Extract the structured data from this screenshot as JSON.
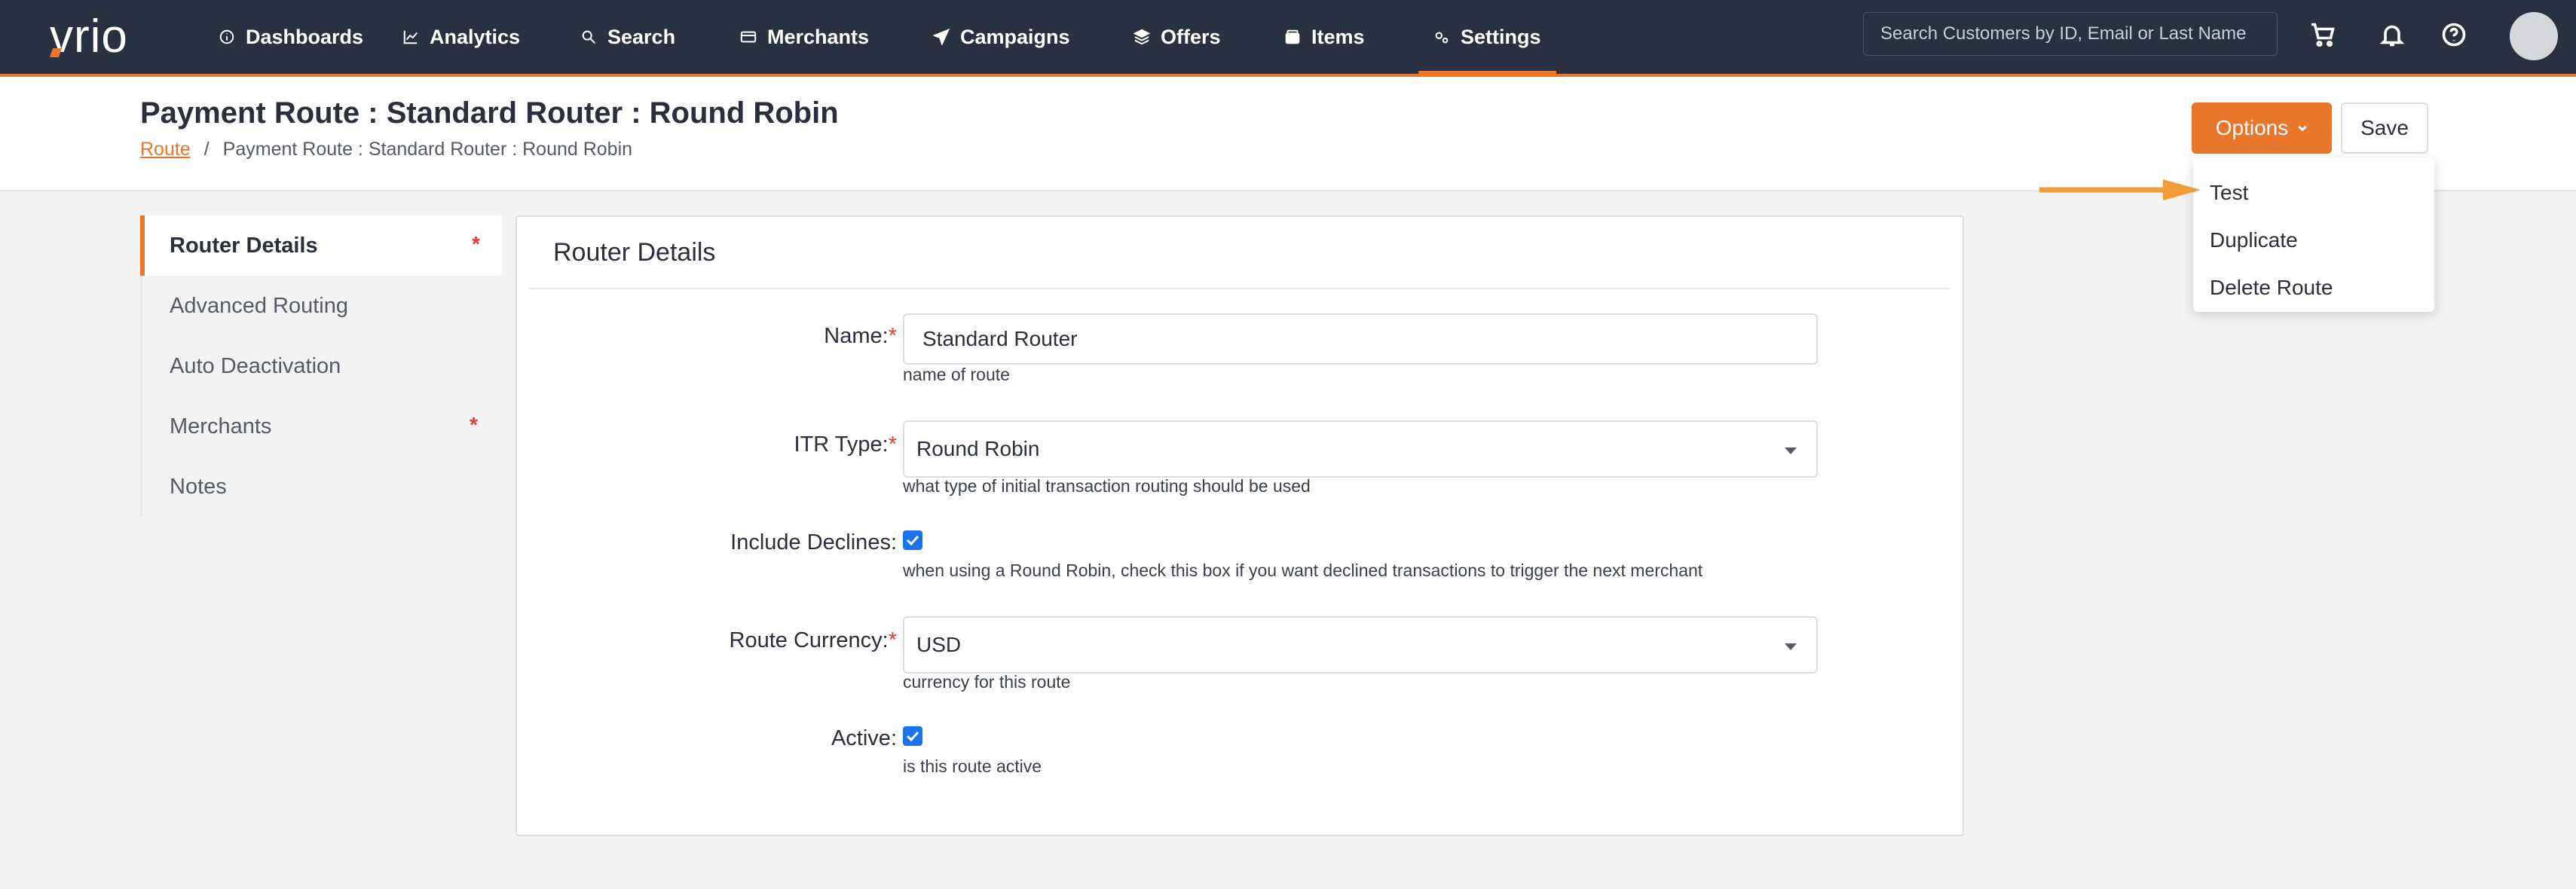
{
  "app": {
    "logo_text": "vrio"
  },
  "nav": {
    "items": [
      {
        "label": "Dashboards",
        "icon": "info-circle-icon"
      },
      {
        "label": "Analytics",
        "icon": "line-chart-icon"
      },
      {
        "label": "Search",
        "icon": "search-icon"
      },
      {
        "label": "Merchants",
        "icon": "credit-card-icon"
      },
      {
        "label": "Campaigns",
        "icon": "paper-plane-icon"
      },
      {
        "label": "Offers",
        "icon": "layers-icon"
      },
      {
        "label": "Items",
        "icon": "box-icon"
      },
      {
        "label": "Settings",
        "icon": "cogs-icon",
        "active": true
      }
    ],
    "search_placeholder": "Search Customers by ID, Email or Last Name",
    "accent_color": "#e8772c",
    "background_color": "#293042"
  },
  "header": {
    "title": "Payment Route : Standard Router : Round Robin",
    "breadcrumb": {
      "link": "Route",
      "separator": "/",
      "current": "Payment Route : Standard Router : Round Robin"
    },
    "options_label": "Options",
    "save_label": "Save"
  },
  "options_menu": {
    "items": [
      "Test",
      "Duplicate",
      "Delete Route"
    ]
  },
  "side_menu": {
    "items": [
      {
        "label": "Router Details",
        "active": true,
        "required": "*"
      },
      {
        "label": "Advanced Routing"
      },
      {
        "label": "Auto Deactivation"
      },
      {
        "label": "Merchants",
        "required": "*"
      },
      {
        "label": "Notes"
      }
    ]
  },
  "form": {
    "title": "Router Details",
    "name": {
      "label": "Name:",
      "required": "*",
      "value": "Standard Router",
      "help": "name of route"
    },
    "itr_type": {
      "label": "ITR Type:",
      "required": "*",
      "value": "Round Robin",
      "help": "what type of initial transaction routing should be used"
    },
    "include_declines": {
      "label": "Include Declines:",
      "checked": true,
      "help": "when using a Round Robin, check this box if you want declined transactions to trigger the next merchant"
    },
    "route_currency": {
      "label": "Route Currency:",
      "required": "*",
      "value": "USD",
      "help": "currency for this route"
    },
    "active": {
      "label": "Active:",
      "checked": true,
      "help": "is this route active"
    }
  }
}
